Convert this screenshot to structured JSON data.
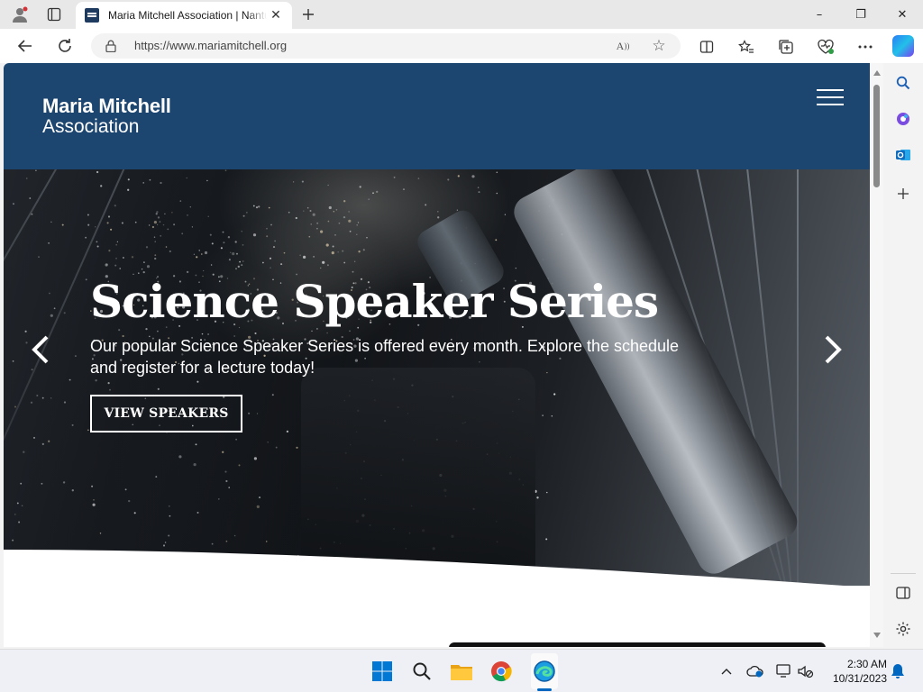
{
  "browser": {
    "tab_title": "Maria Mitchell Association | Nantucket",
    "url": "https://www.mariamitchell.org",
    "read_aloud_label": "A",
    "window_controls": {
      "minimize": "–",
      "maximize": "❐",
      "close": "✕"
    },
    "toolbar_icons": [
      "split-screen-icon",
      "favorites-icon",
      "collections-icon",
      "browser-essentials-icon",
      "more-icon",
      "copilot-icon"
    ]
  },
  "site": {
    "logo_line1": "Maria Mitchell",
    "logo_line2": "Association"
  },
  "hero": {
    "title": "Science Speaker Series",
    "text": "Our popular Science Speaker Series is offered every month. Explore the schedule and register for a lecture today!",
    "button_label": "VIEW SPEAKERS"
  },
  "edge_sidebar": [
    "search-icon",
    "copilot-designer-icon",
    "outlook-icon",
    "add-icon",
    "sidebar-toggle-icon",
    "settings-icon"
  ],
  "taskbar": {
    "apps": [
      "start-icon",
      "search-icon",
      "file-explorer-icon",
      "chrome-icon",
      "edge-icon"
    ],
    "time": "2:30 AM",
    "date": "10/31/2023"
  },
  "colors": {
    "header_bg": "#1c4670",
    "accent": "#0067c0"
  }
}
